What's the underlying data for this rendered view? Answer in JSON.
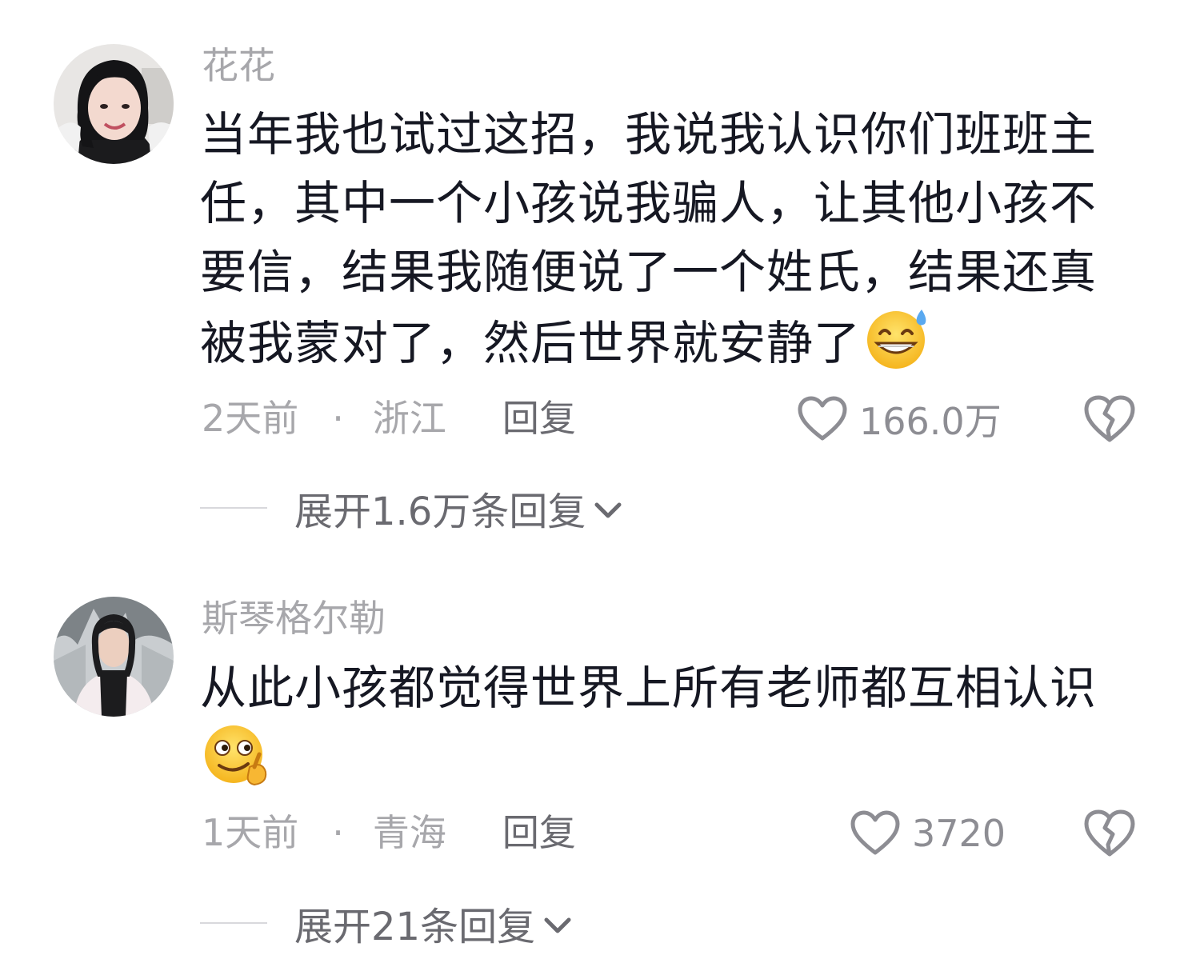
{
  "comments": [
    {
      "username": "花花",
      "text": "当年我也试过这招，我说我认识你们班班主任，其中一个小孩说我骗人，让其他小孩不要信，结果我随便说了一个姓氏，结果还真被我蒙对了，然后世界就安静了",
      "emoji": "grinning-sweat-emoji",
      "time": "2天前",
      "separator": "·",
      "location": "浙江",
      "reply_label": "回复",
      "like_count": "166.0万",
      "expand_label": "展开1.6万条回复"
    },
    {
      "username": "斯琴格尔勒",
      "text": "从此小孩都觉得世界上所有老师都互相认识",
      "emoji": "smirk-hand-emoji",
      "time": "1天前",
      "separator": "·",
      "location": "青海",
      "reply_label": "回复",
      "like_count": "3720",
      "expand_label": "展开21条回复"
    }
  ],
  "colors": {
    "text": "#161823",
    "secondary": "#a7a7ab",
    "action": "#6a6a70",
    "icon": "#8d8d93"
  },
  "icons": [
    "heart-icon",
    "broken-heart-icon",
    "chevron-down-icon"
  ]
}
